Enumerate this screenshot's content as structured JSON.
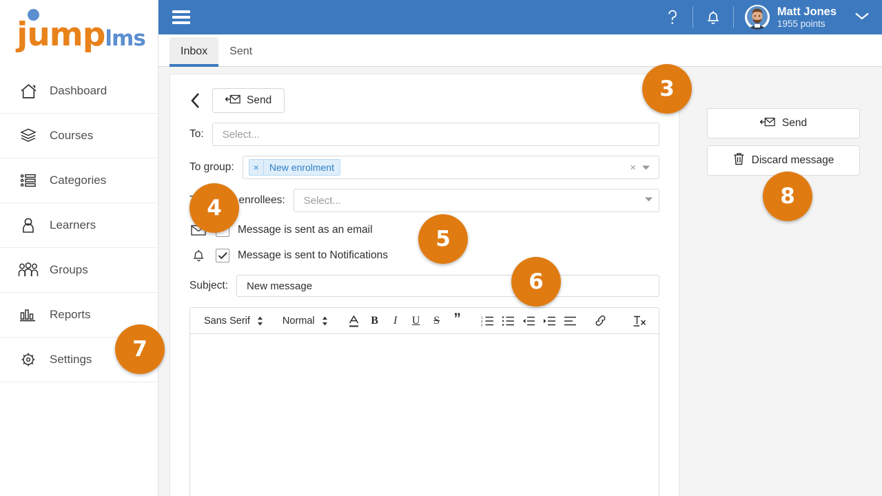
{
  "brand": {
    "name_primary": "jump",
    "name_secondary": "lms",
    "color_primary": "#e8821a",
    "color_secondary": "#5b8fd0"
  },
  "sidebar": {
    "items": [
      {
        "label": "Dashboard",
        "icon": "home-icon"
      },
      {
        "label": "Courses",
        "icon": "books-icon"
      },
      {
        "label": "Categories",
        "icon": "list-icon"
      },
      {
        "label": "Learners",
        "icon": "user-icon"
      },
      {
        "label": "Groups",
        "icon": "users-icon"
      },
      {
        "label": "Reports",
        "icon": "bar-chart-icon"
      },
      {
        "label": "Settings",
        "icon": "gear-icon"
      }
    ]
  },
  "topbar": {
    "menu_icon": "hamburger-icon",
    "help_icon": "question-mark-icon",
    "bell_icon": "bell-icon",
    "user_name": "Matt Jones",
    "user_points": "1955 points",
    "caret_icon": "chevron-down-icon",
    "accent_color": "#3d79bf"
  },
  "tabs": [
    {
      "label": "Inbox",
      "active": true
    },
    {
      "label": "Sent",
      "active": false
    }
  ],
  "compose": {
    "back_icon": "chevron-left-icon",
    "send_label": "Send",
    "send_icon": "send-mail-icon",
    "to_label": "To:",
    "to_placeholder": "Select...",
    "to_group_label": "To group:",
    "to_group_tag": "New enrolment",
    "to_group_tag_remove": "×",
    "to_group_clear": "×",
    "to_enrollees_label": "To course enrollees:",
    "to_enrollees_placeholder": "Select...",
    "email_check_label": "Message is sent as an email",
    "email_check_checked": false,
    "email_icon": "envelope-icon",
    "notify_check_label": "Message is sent to Notifications",
    "notify_check_checked": true,
    "notify_icon": "bell-icon",
    "subject_label": "Subject:",
    "subject_value": "New message",
    "body_value": ""
  },
  "editor_toolbar": {
    "font_family": "Sans Serif",
    "font_size": "Normal",
    "buttons": [
      {
        "name": "text-color-icon",
        "glyph": "A"
      },
      {
        "name": "bold-icon",
        "glyph": "B"
      },
      {
        "name": "italic-icon",
        "glyph": "I"
      },
      {
        "name": "underline-icon",
        "glyph": "U"
      },
      {
        "name": "strikethrough-icon",
        "glyph": "S"
      },
      {
        "name": "blockquote-icon",
        "glyph": "”"
      },
      {
        "name": "ordered-list-icon",
        "glyph": ""
      },
      {
        "name": "bullet-list-icon",
        "glyph": ""
      },
      {
        "name": "outdent-icon",
        "glyph": ""
      },
      {
        "name": "indent-icon",
        "glyph": ""
      },
      {
        "name": "align-icon",
        "glyph": ""
      },
      {
        "name": "link-icon",
        "glyph": ""
      },
      {
        "name": "clear-format-icon",
        "glyph": ""
      }
    ]
  },
  "actions": {
    "send_label": "Send",
    "send_icon": "send-mail-icon",
    "discard_label": "Discard message",
    "discard_icon": "trash-icon"
  },
  "callouts": [
    {
      "number": "3"
    },
    {
      "number": "4"
    },
    {
      "number": "5"
    },
    {
      "number": "6"
    },
    {
      "number": "7"
    },
    {
      "number": "8"
    }
  ],
  "colors": {
    "callout": "#e07b12",
    "header_blue": "#3d79bf",
    "tag_blue": "#2e7fc4"
  }
}
